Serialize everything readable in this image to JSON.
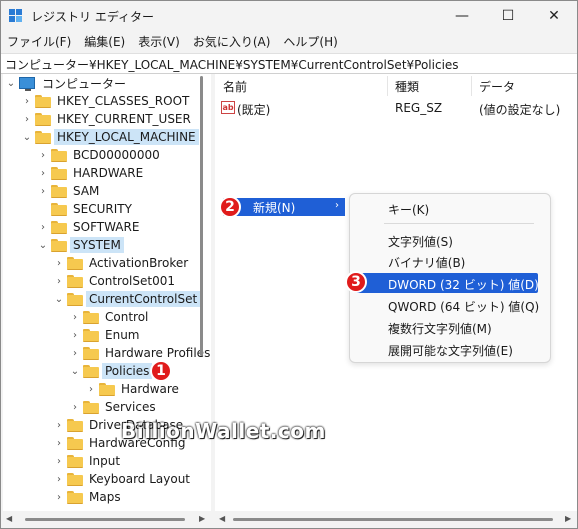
{
  "window": {
    "title": "レジストリ エディター",
    "minimize": "—",
    "maximize": "☐",
    "close": "✕"
  },
  "menu": [
    "ファイル(F)",
    "編集(E)",
    "表示(V)",
    "お気に入り(A)",
    "ヘルプ(H)"
  ],
  "address": "コンピューター¥HKEY_LOCAL_MACHINE¥SYSTEM¥CurrentControlSet¥Policies",
  "tree": {
    "root": "コンピューター",
    "items": [
      {
        "label": "HKEY_CLASSES_ROOT",
        "chev": "›"
      },
      {
        "label": "HKEY_CURRENT_USER",
        "chev": "›"
      },
      {
        "label": "HKEY_LOCAL_MACHINE",
        "chev": "⌄"
      },
      {
        "label": "BCD00000000",
        "chev": "›"
      },
      {
        "label": "HARDWARE",
        "chev": "›"
      },
      {
        "label": "SAM",
        "chev": "›"
      },
      {
        "label": "SECURITY",
        "chev": ""
      },
      {
        "label": "SOFTWARE",
        "chev": "›"
      },
      {
        "label": "SYSTEM",
        "chev": "⌄"
      },
      {
        "label": "ActivationBroker",
        "chev": "›"
      },
      {
        "label": "ControlSet001",
        "chev": "›"
      },
      {
        "label": "CurrentControlSet",
        "chev": "⌄"
      },
      {
        "label": "Control",
        "chev": "›"
      },
      {
        "label": "Enum",
        "chev": "›"
      },
      {
        "label": "Hardware Profiles",
        "chev": "›"
      },
      {
        "label": "Policies",
        "chev": "⌄"
      },
      {
        "label": "Hardware",
        "chev": "›"
      },
      {
        "label": "Services",
        "chev": "›"
      },
      {
        "label": "DriverDatabase",
        "chev": "›"
      },
      {
        "label": "HardwareConfig",
        "chev": "›"
      },
      {
        "label": "Input",
        "chev": "›"
      },
      {
        "label": "Keyboard Layout",
        "chev": "›"
      },
      {
        "label": "Maps",
        "chev": "›"
      }
    ]
  },
  "list": {
    "columns": [
      "名前",
      "種類",
      "データ"
    ],
    "rows": [
      {
        "icon": "ab",
        "name": "(既定)",
        "type": "REG_SZ",
        "data": "(値の設定なし)"
      }
    ]
  },
  "context_menu": {
    "new_label": "新規(N)",
    "new_arrow": "›",
    "submenu": [
      "キー(K)",
      "文字列値(S)",
      "バイナリ値(B)",
      "DWORD (32 ビット) 値(D)",
      "QWORD (64 ビット) 値(Q)",
      "複数行文字列値(M)",
      "展開可能な文字列値(E)"
    ]
  },
  "badges": [
    "1",
    "2",
    "3"
  ],
  "watermark": "BillionWallet.com",
  "colors": {
    "highlight": "#1f5fd6",
    "selection": "#cce4f7",
    "badge": "#e01b1b"
  }
}
